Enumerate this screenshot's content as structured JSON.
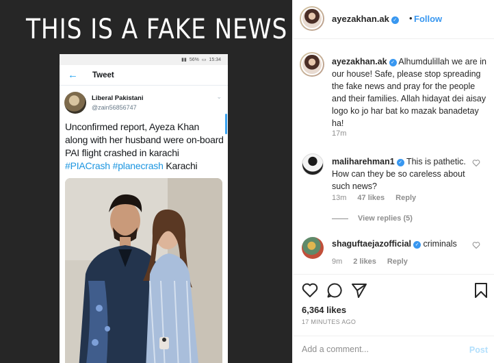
{
  "post_image": {
    "overlay_title": "THIS IS A FAKE NEWS",
    "phone": {
      "status": {
        "battery": "56%",
        "time": "15:34"
      },
      "header_title": "Tweet",
      "author_name": "Liberal Pakistani",
      "author_handle": "@zain56856747",
      "tweet_text": "Unconfirmed report, Ayeza Khan along with her husband were on-board PAI flight crashed in karachi",
      "hashtags": [
        "#PIACrash",
        "#planecrash"
      ],
      "tweet_tail": "Karachi"
    }
  },
  "header": {
    "username": "ayezakhan.ak",
    "separator": "•",
    "follow_label": "Follow"
  },
  "caption": {
    "username": "ayezakhan.ak",
    "text": "Alhumdulillah we are in our house! Safe, please stop spreading the fake news and pray for the people and their families. Allah hidayat dei aisay logo ko jo har bat ko mazak banadetay ha!",
    "time": "17m"
  },
  "comments": [
    {
      "username": "malihar ehman1",
      "username_display": "maliharehman1",
      "text": "This is pathetic. How can they be so careless about such news?",
      "time": "13m",
      "likes": "47 likes",
      "reply_label": "Reply",
      "view_replies": "View replies (5)"
    },
    {
      "username_display": "shaguftaejazofficial",
      "text": "criminals",
      "time": "9m",
      "likes": "2 likes",
      "reply_label": "Reply"
    }
  ],
  "actions": {
    "likes": "6,364 likes",
    "post_time": "17 MINUTES AGO",
    "comment_placeholder": "Add a comment...",
    "post_label": "Post"
  },
  "colors": {
    "accent": "#3897f0",
    "post_disabled": "#b2dffc",
    "hashtag": "#1b95e0",
    "muted": "#8e8e8e"
  },
  "icons": [
    "heart-icon",
    "comment-icon",
    "share-icon",
    "bookmark-icon",
    "verified-icon",
    "back-arrow-icon"
  ]
}
